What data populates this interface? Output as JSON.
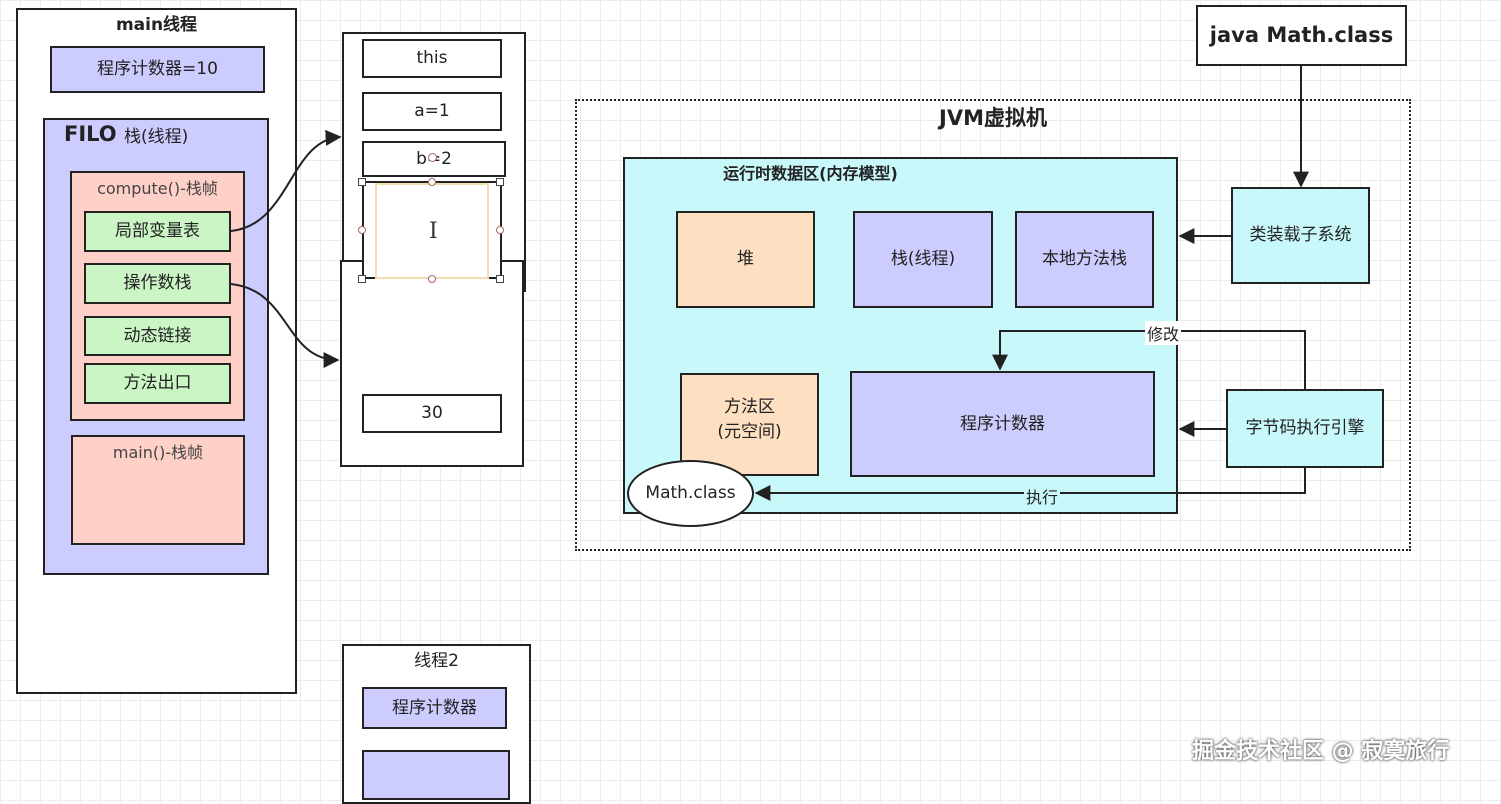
{
  "main_thread": {
    "title": "main线程",
    "pc_label": "程序计数器=10",
    "stack": {
      "filo": "FILO",
      "title": "栈(线程)",
      "compute_frame": {
        "title": "compute()-栈帧",
        "items": [
          "局部变量表",
          "操作数栈",
          "动态链接",
          "方法出口"
        ]
      },
      "main_frame": {
        "title": "main()-栈帧"
      }
    }
  },
  "locals_panel": {
    "items": [
      "this",
      "a=1",
      "b=2"
    ],
    "cursor": "I"
  },
  "operand_panel": {
    "value": "30"
  },
  "thread2": {
    "title": "线程2",
    "pc_label": "程序计数器"
  },
  "jvm": {
    "title": "JVM虚拟机",
    "runtime_area": {
      "title": "运行时数据区(内存模型)",
      "heap": "堆",
      "stack": "栈(线程)",
      "native_stack": "本地方法栈",
      "method_area_line1": "方法区",
      "method_area_line2": "(元空间)",
      "pc": "程序计数器",
      "math_class": "Math.class"
    },
    "class_loader": "类装载子系统",
    "engine": "字节码执行引擎",
    "modify_label": "修改",
    "execute_label": "执行"
  },
  "java_cmd": "java Math.class",
  "watermark": "掘金技术社区 @ 寂寞旅行",
  "colors": {
    "blue": "#ccccff",
    "pink": "#ffd0c8",
    "green": "#ccf5c6",
    "cyan": "#c8f8fa",
    "peach": "#fde0c2",
    "white": "#ffffff"
  }
}
